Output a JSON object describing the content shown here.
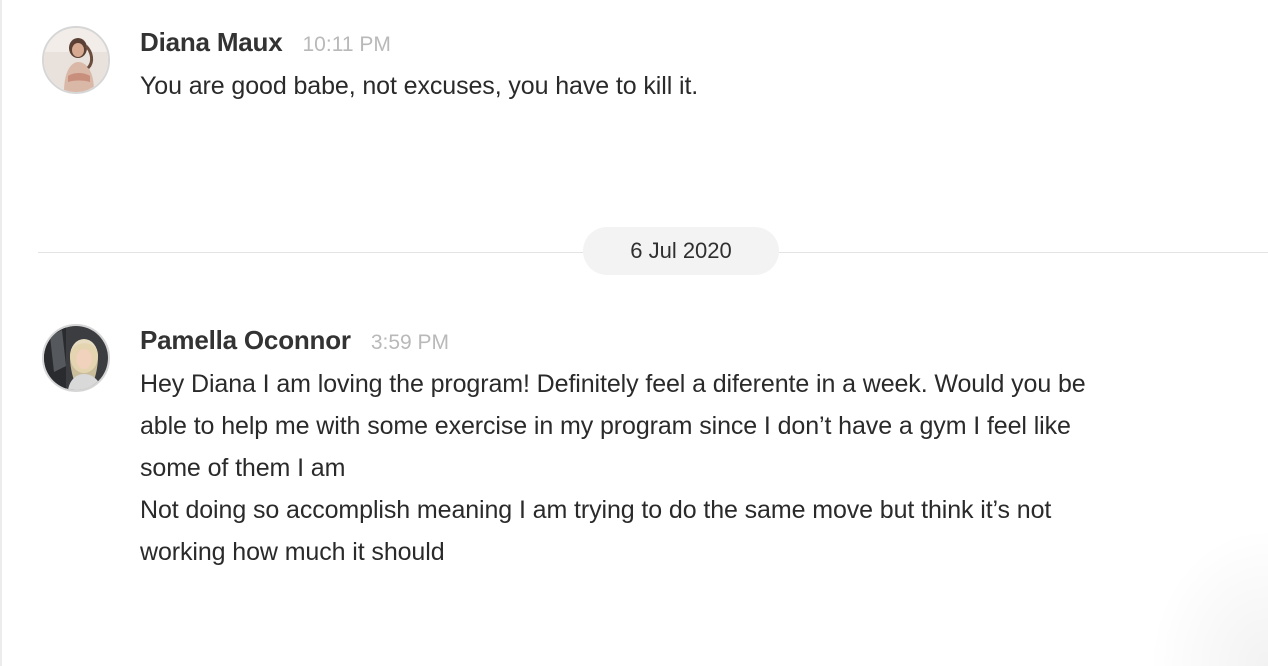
{
  "messages": [
    {
      "sender": "Diana Maux",
      "time": "10:11 PM",
      "avatar_icon": "user-photo-diana",
      "lines": [
        "You are good babe, not excuses, you have to kill it."
      ]
    },
    {
      "sender": "Pamella Oconnor",
      "time": "3:59 PM",
      "avatar_icon": "user-photo-pamella",
      "lines": [
        "Hey Diana I am loving the program! Definitely feel a diferente in a week. Would you be",
        "able to help me with some exercise in my program since I don’t have a gym I feel like",
        "some of them I am",
        "Not doing so accomplish meaning I am trying to do the same move but think it’s not",
        "working how much it should"
      ]
    }
  ],
  "date_divider": {
    "label": "6 Jul 2020"
  },
  "colors": {
    "sender": "#333333",
    "time": "#b9b9b9",
    "divider_line": "#e3e3e3",
    "date_pill_bg": "#f3f3f3"
  }
}
